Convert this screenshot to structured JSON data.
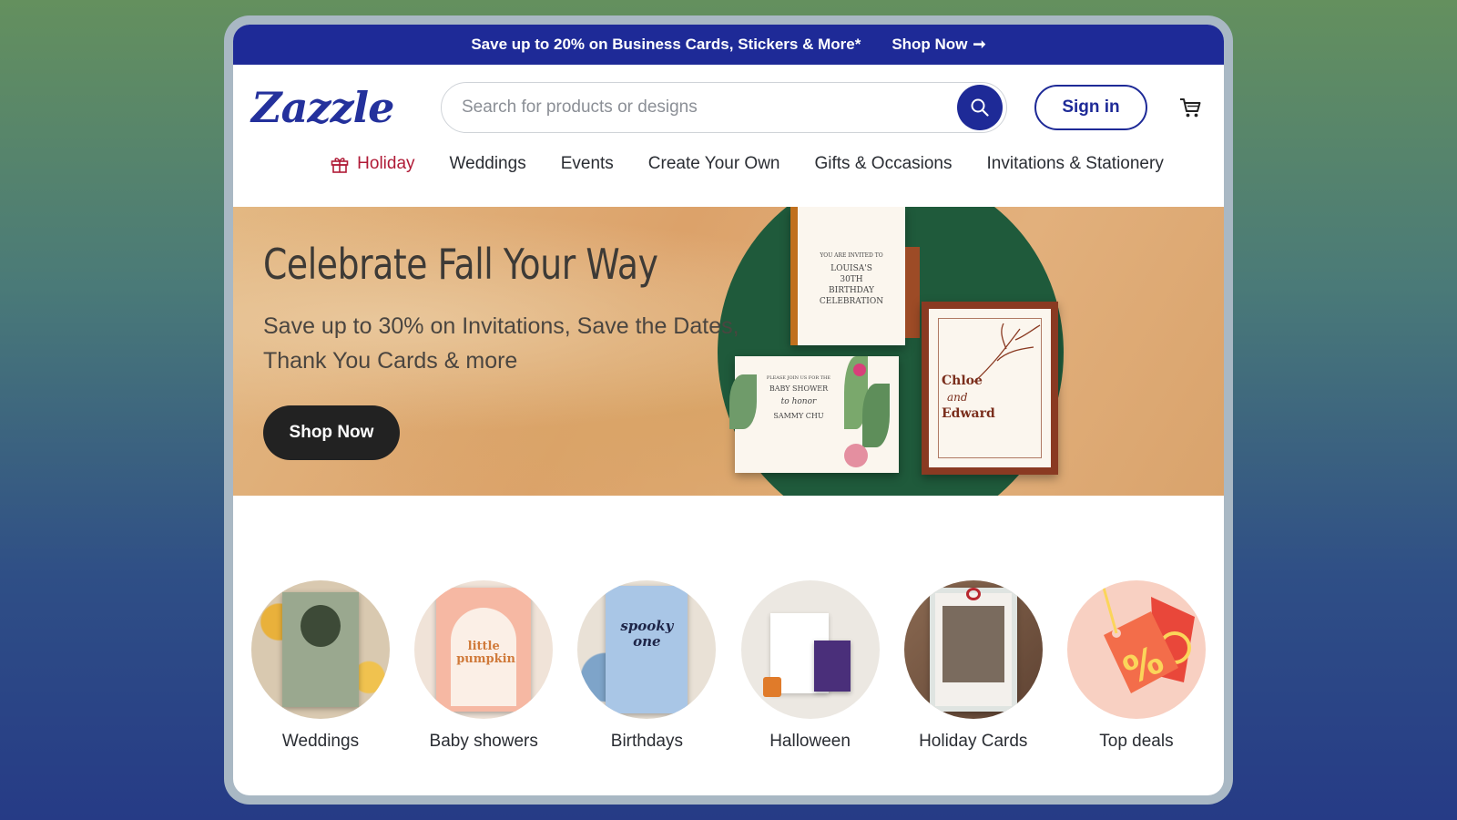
{
  "promo": {
    "text": "Save up to 20% on Business Cards, Stickers & More*",
    "link": "Shop Now",
    "arrow": "➞"
  },
  "header": {
    "logo": "Zazzle",
    "search_placeholder": "Search for products or designs",
    "signin": "Sign in"
  },
  "nav": {
    "items": [
      {
        "label": "Holiday",
        "active": true
      },
      {
        "label": "Weddings"
      },
      {
        "label": "Events"
      },
      {
        "label": "Create Your Own"
      },
      {
        "label": "Gifts & Occasions"
      },
      {
        "label": "Invitations & Stationery"
      }
    ]
  },
  "hero": {
    "title": "Celebrate Fall Your Way",
    "subtitle": "Save up to 30% on Invitations, Save the Dates, Thank You Cards & more",
    "button": "Shop Now",
    "cards": {
      "birthday": [
        "YOU ARE INVITED TO",
        "LOUISA'S",
        "30TH",
        "BIRTHDAY",
        "CELEBRATION"
      ],
      "shower": [
        "PLEASE JOIN US FOR THE",
        "BABY SHOWER",
        "to honor",
        "SAMMY CHU"
      ],
      "wedding": [
        "Chloe",
        "and",
        "Edward"
      ]
    }
  },
  "categories": [
    {
      "label": "Weddings",
      "color": "#8a9a84"
    },
    {
      "label": "Baby showers",
      "color": "#f1b9a2"
    },
    {
      "label": "Birthdays",
      "color": "#8fb3d8"
    },
    {
      "label": "Halloween",
      "color": "#e8e2d9"
    },
    {
      "label": "Holiday Cards",
      "color": "#7b5a44"
    },
    {
      "label": "Top deals",
      "color": "#f6c7b7"
    }
  ],
  "colors": {
    "brand": "#1e2a97",
    "holiday": "#b01a36"
  }
}
